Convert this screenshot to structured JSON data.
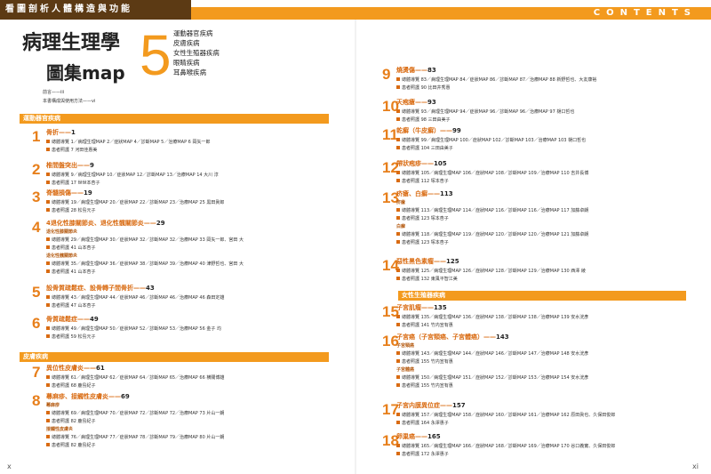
{
  "header": {
    "tagline": "看圖剖析人體構造與功能",
    "contents": "CONTENTS"
  },
  "title": {
    "main": "病理生理學",
    "sub": "圖集map",
    "volume": "5",
    "topics": [
      "運動器官疾病",
      "皮膚疾病",
      "女性生殖器疾病",
      "眼睛疾病",
      "耳鼻喉疾病"
    ]
  },
  "front_matter": [
    "前言——iii",
    "本書構成與使用方法——vi"
  ],
  "sections": {
    "musculoskeletal": "運動器官疾病",
    "skin": "皮膚疾病",
    "female": "女性生殖器疾病"
  },
  "left_entries": [
    {
      "num": "1",
      "title": "骨折——",
      "page": "1",
      "lines": [
        "總體導覽 1／病理生理MAP 2／症狀MAP 4／診斷MAP 5／治療MAP 6 岡矢一郎",
        "患者照護 7 河田佳惠美"
      ]
    },
    {
      "num": "2",
      "title": "椎間盤突出——",
      "page": "9",
      "lines": [
        "總體導覽 9／病理生理MAP 10／症狀MAP 12／診斷MAP 13／治療MAP 14 大川 淳",
        "患者照護 17 世世本杏子"
      ]
    },
    {
      "num": "3",
      "title": "脊髓損傷——",
      "page": "19",
      "lines": [
        "總體導覽 19／病理生理MAP 20／症狀MAP 22／診斷MAP 23／治療MAP 25 黒田眞郎",
        "患者照護 28 松島元子"
      ]
    },
    {
      "num": "4",
      "title": "4退化性膝關節炎、退化性髖關節炎——",
      "page": "29",
      "sub1": "退化性膝關節炎",
      "lines1": [
        "總體導覽 29／病理生理MAP 30／症狀MAP 32／診斷MAP 32／治療MAP 33 岡矢一郎、宮田 大",
        "患者照護 41 山本杏子"
      ],
      "sub2": "退化性髖關節炎",
      "lines2": [
        "總體導覽 35／病理生理MAP 36／症狀MAP 38／診斷MAP 39／治療MAP 40 津野哲也、宮田 大",
        "患者照護 41 山本杏子"
      ]
    },
    {
      "num": "5",
      "title": "設骨質疏鬆症、設骨轉子間骨折——",
      "page": "43",
      "lines": [
        "總體導覽 43／病理生理MAP 44／症狀MAP 46／診斷MAP 46／治療MAP 46 森田定雄",
        "患者照護 47 山本杏子"
      ]
    },
    {
      "num": "6",
      "title": "骨質疏鬆症——",
      "page": "49",
      "lines": [
        "總體導覽 49／病理生理MAP 50／症狀MAP 52／診斷MAP 53／治療MAP 56 金子 均",
        "患者照護 59 松島元子"
      ]
    },
    {
      "num": "7",
      "title": "異位性皮膚炎——",
      "page": "61",
      "lines": [
        "總體導覽 61／病理生理MAP 62／症狀MAP 64／診斷MAP 65／治療MAP 66 横關博雄",
        "患者照護 68 鹿島紀子"
      ]
    },
    {
      "num": "8",
      "title": "蕁麻疹、接觸性皮膚炎——",
      "page": "69",
      "sub1": "蕁麻疹",
      "lines1": [
        "總體導覽 69／病理生理MAP 70／症狀MAP 72／診斷MAP 72／治療MAP 73 片山一朗",
        "患者照護 82 鹿島紀子"
      ],
      "sub2": "接觸性皮膚炎",
      "lines2": [
        "總體導覽 76／病理生理MAP 77／症狀MAP 78／診斷MAP 79／治療MAP 80 片山一朗",
        "患者照護 82 鹿島紀子"
      ]
    }
  ],
  "right_entries": [
    {
      "num": "9",
      "title": "燒燙傷——",
      "page": "83",
      "lines": [
        "總體導覽 83／病理生理MAP 84／症狀MAP 86／診斷MAP 87／治療MAP 88 新野哲也、大友康裕",
        "患者照護 90 比田井秀惠"
      ]
    },
    {
      "num": "10",
      "title": "天疱瘡——",
      "page": "93",
      "lines": [
        "總體導覽 93／病理生理MAP 94／症狀MAP 96／診斷MAP 96／治療MAP 97 樋口哲也",
        "患者照護 98 三田由美子"
      ]
    },
    {
      "num": "11",
      "title": "乾癬（牛皮癬）——",
      "page": "99",
      "lines": [
        "總體導覽 99／病理生理MAP 100／症狀MAP 102／診斷MAP 103／治療MAP 103 樋口哲也",
        "患者照護 104 三田由美子"
      ]
    },
    {
      "num": "12",
      "title": "帶狀疱疹——",
      "page": "105",
      "lines": [
        "總體導覽 105／病理生理MAP 106／症狀MAP 108／診斷MAP 109／治療MAP 110 吉井長博",
        "患者照護 112 塚本杏子"
      ]
    },
    {
      "num": "13",
      "title": "疥瘡、白癬——",
      "page": "113",
      "sub1": "疥瘡",
      "lines1": [
        "總體導覽 113／病理生理MAP 114／症狀MAP 116／診斷MAP 116／治療MAP 117 加藤卓朗",
        "患者照護 123 塚本杏子"
      ],
      "sub2": "白癬",
      "lines2": [
        "總體導覽 118／病理生理MAP 119／症狀MAP 120／診斷MAP 120／治療MAP 121 加藤卓朗",
        "患者照護 123 塚本杏子"
      ]
    },
    {
      "num": "14",
      "title": "惡性黑色素瘤——",
      "page": "125",
      "lines": [
        "總體導覽 125／病理生理MAP 126／症狀MAP 128／診斷MAP 129／治療MAP 130 西澤 綾",
        "患者照護 132 東風平智江美"
      ]
    },
    {
      "num": "15",
      "title": "子宮肌瘤——",
      "page": "135",
      "lines": [
        "總體導覽 135／病理生理MAP 136／症狀MAP 138／診斷MAP 138／治療MAP 139 安水洸彥",
        "患者照護 141 竹内宣有惠"
      ]
    },
    {
      "num": "16",
      "title": "子宮癌（子宮頸癌、子宮體癌）——",
      "page": "143",
      "sub1": "子宮頸癌",
      "lines1": [
        "總體導覽 143／病理生理MAP 144／症狀MAP 146／診斷MAP 147／治療MAP 148 安水洸彥",
        "患者照護 155 竹内宣有惠"
      ],
      "sub2": "子宮體癌",
      "lines2": [
        "總體導覽 150／病理生理MAP 151／症狀MAP 152／診斷MAP 153／治療MAP 154 安水洸彥",
        "患者照護 155 竹内宣有惠"
      ]
    },
    {
      "num": "17",
      "title": "子宮内膜異位症——",
      "page": "157",
      "lines": [
        "總體導覽 157／病理生理MAP 158／症狀MAP 160／診斷MAP 161／治療MAP 162 原田眞也、久保田俊郎",
        "患者照護 164 永澤惠子"
      ]
    },
    {
      "num": "18",
      "title": "卵巢癌——",
      "page": "165",
      "lines": [
        "總體導覽 165／病理生理MAP 166／症狀MAP 168／診斷MAP 169／治療MAP 170 谷口義實、久保田俊郎",
        "患者照護 172 永澤惠子"
      ]
    }
  ],
  "page_numbers": {
    "left": "x",
    "right": "xi"
  },
  "colors": {
    "accent": "#f39a1e",
    "title_orange": "#d96b12",
    "dark_brown": "#5c3a14"
  }
}
